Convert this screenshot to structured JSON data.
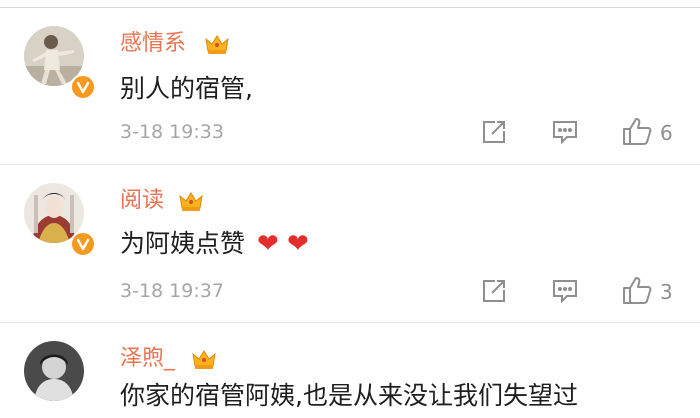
{
  "comments": [
    {
      "username": "感情系",
      "text": "别人的宿管,",
      "time": "3-18 19:33",
      "likes": "6",
      "icons": [
        "share-icon",
        "comment-icon",
        "like-icon"
      ]
    },
    {
      "username": "阅读",
      "text": "为阿姨点赞",
      "time": "3-18 19:37",
      "likes": "3",
      "emoji": "❤ ❤",
      "icons": [
        "share-icon",
        "comment-icon",
        "like-icon"
      ]
    },
    {
      "username": "泽煦_",
      "text": "你家的宿管阿姨,也是从来没让我们失望过"
    }
  ],
  "colors": {
    "username": "#eb7350",
    "verified": "#f59a21",
    "heart": "#e52d2d",
    "meta": "#a6a6a6"
  }
}
